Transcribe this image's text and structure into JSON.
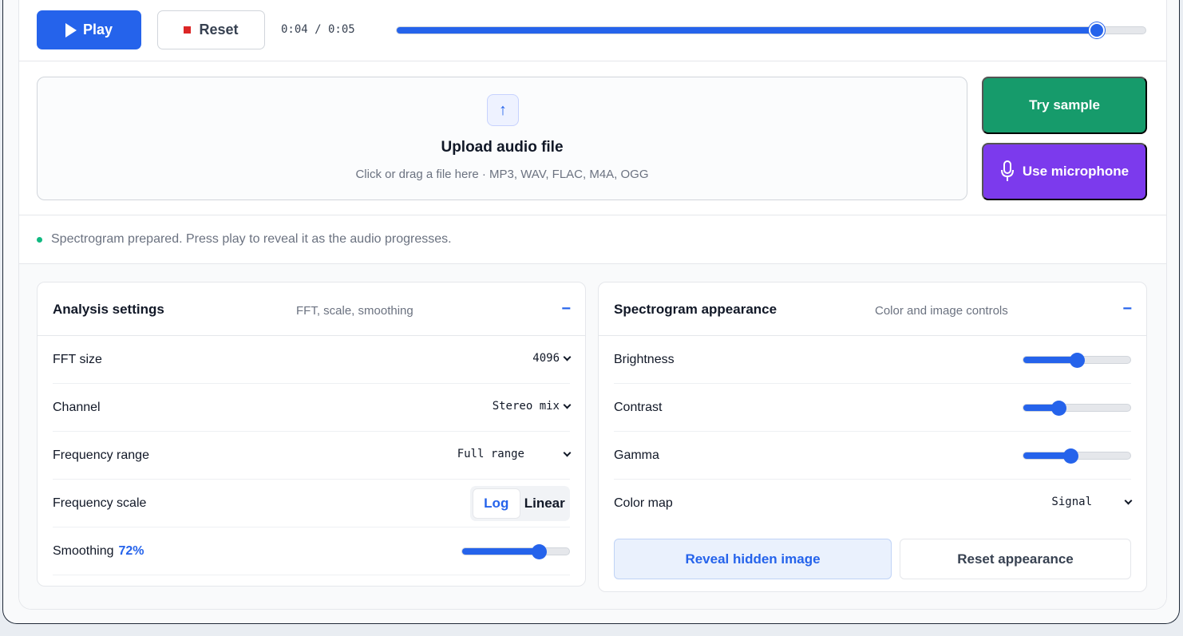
{
  "player": {
    "play_label": "Play",
    "reset_label": "Reset",
    "time": "0:04 / 0:05",
    "progress": 0.935,
    "accent": "#2563eb"
  },
  "upload": {
    "title": "Upload audio file",
    "subtitle": "Click or drag a file here · MP3, WAV, FLAC, M4A, OGG",
    "icon": "upload-arrow-icon",
    "icon_glyph": "↑"
  },
  "actions": {
    "sample_label": "Try sample",
    "sample_color": "#169b6b",
    "mic_label": "Use microphone",
    "mic_color": "#7c3aed"
  },
  "status": {
    "text": "Spectrogram prepared. Press play to reveal it as the audio progresses.",
    "color": "#10b981"
  },
  "analysis": {
    "title": "Analysis settings",
    "subtitle": "FFT, scale, smoothing",
    "collapse": "−",
    "fft_label": "FFT size",
    "fft_value": "4096",
    "channel_label": "Channel",
    "channel_value": "Stereo mix",
    "range_label": "Frequency range",
    "range_value": "Full range",
    "scale_label": "Frequency scale",
    "scale_options": [
      "Log",
      "Linear"
    ],
    "scale_selected": "Log",
    "smoothing_label": "Smoothing",
    "smoothing_value": "72%",
    "smoothing_level": 0.72
  },
  "appearance": {
    "title": "Spectrogram appearance",
    "subtitle": "Color and image controls",
    "collapse": "−",
    "brightness_label": "Brightness",
    "brightness_level": 0.5,
    "contrast_label": "Contrast",
    "contrast_level": 0.33,
    "gamma_label": "Gamma",
    "gamma_level": 0.44,
    "colormap_label": "Color map",
    "colormap_value": "Signal",
    "reveal_label": "Reveal hidden image",
    "reset_label": "Reset appearance"
  }
}
